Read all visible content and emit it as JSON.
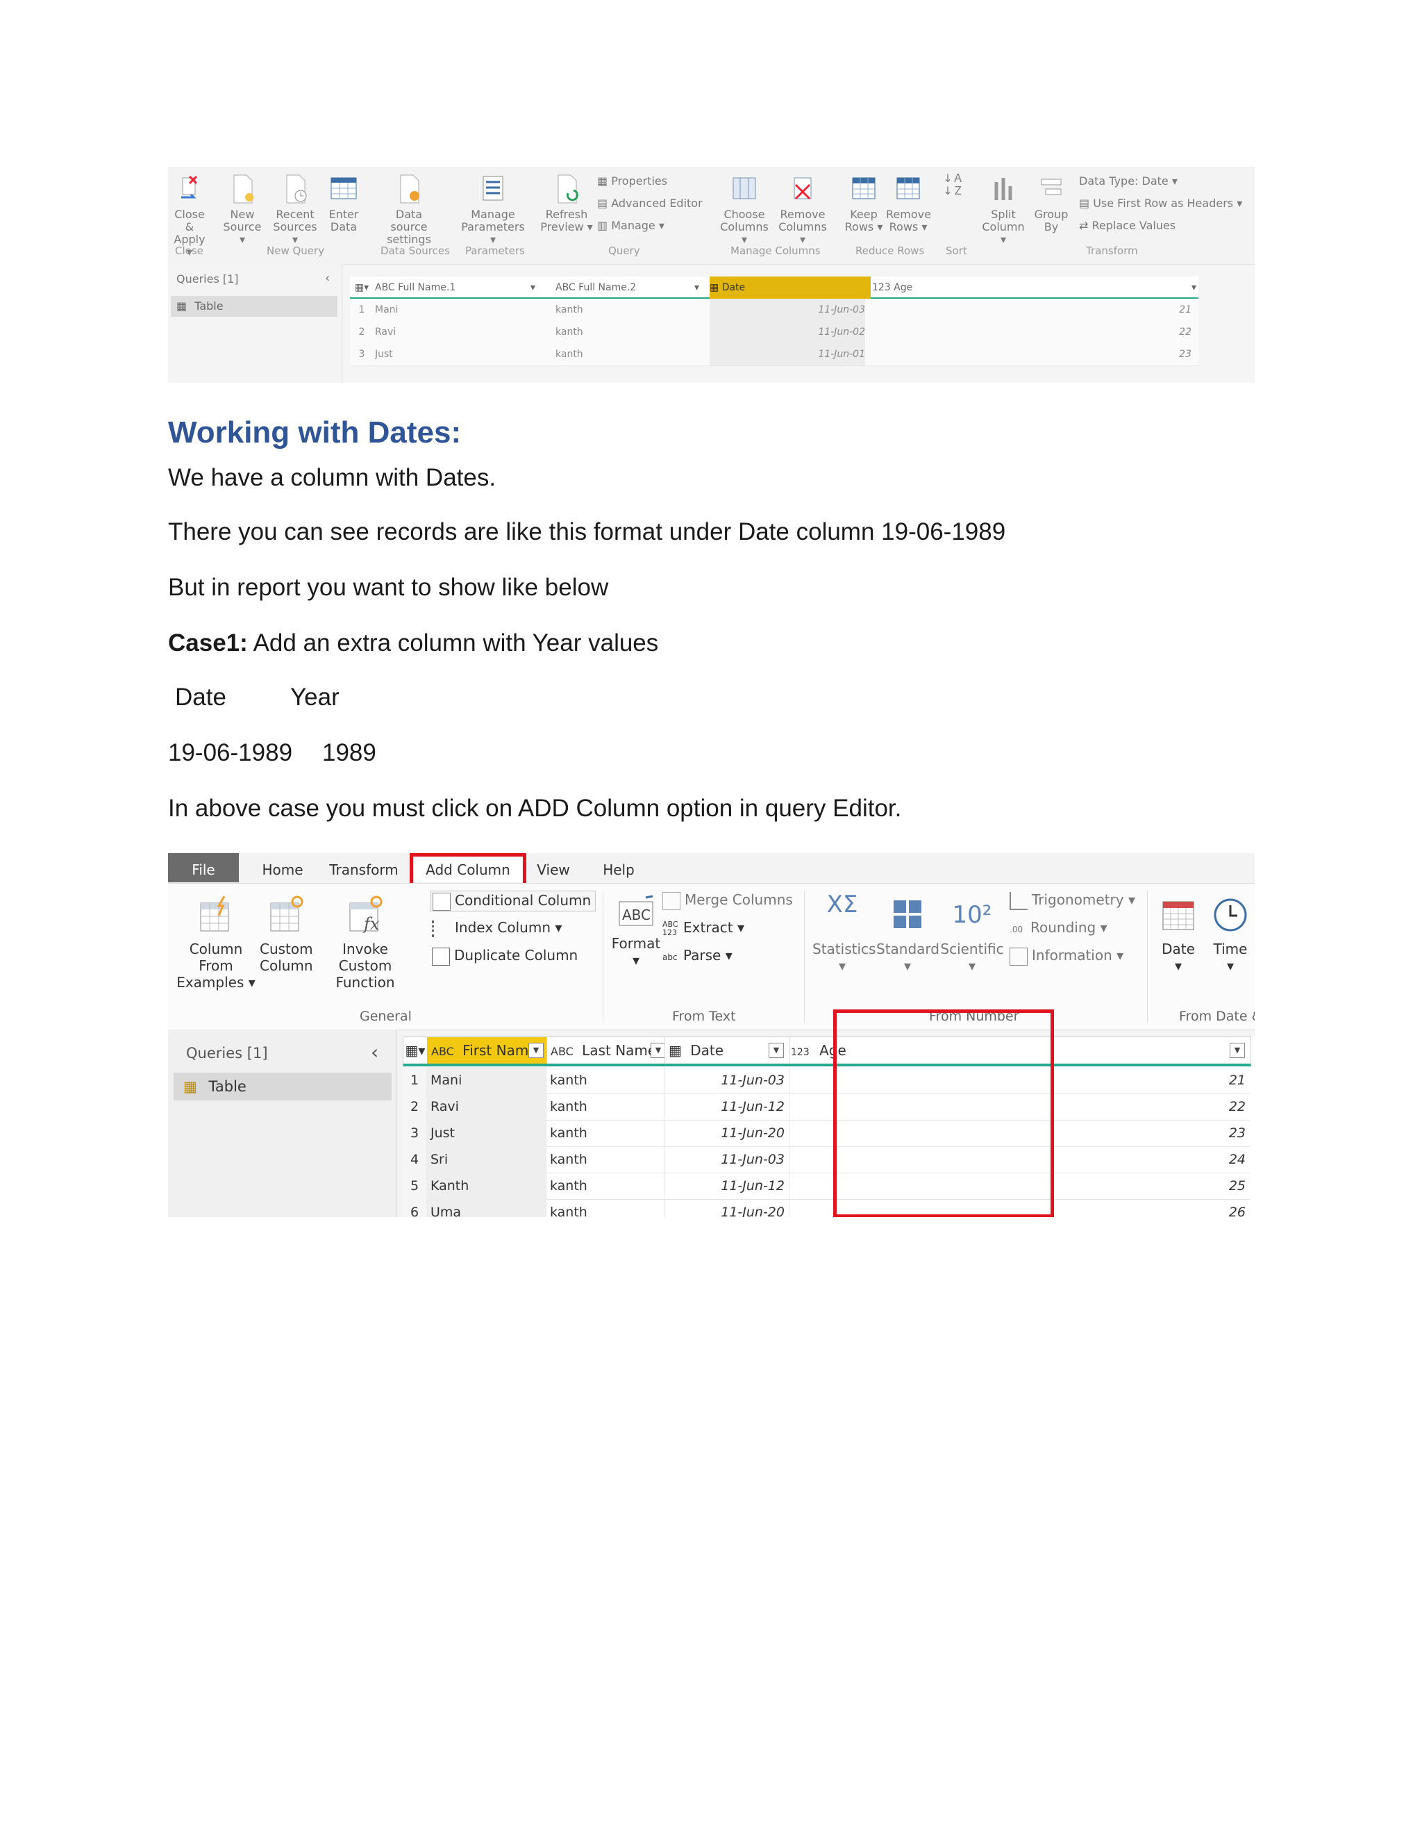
{
  "screenshot1": {
    "ribbon_buttons": [
      {
        "l1": "Close &",
        "l2": "Apply ▾",
        "icon": "close-apply-icon"
      },
      {
        "l1": "New",
        "l2": "Source ▾",
        "icon": "new-source-icon"
      },
      {
        "l1": "Recent",
        "l2": "Sources ▾",
        "icon": "recent-sources-icon"
      },
      {
        "l1": "Enter",
        "l2": "Data",
        "icon": "enter-data-icon"
      },
      {
        "l1": "Data source",
        "l2": "settings",
        "icon": "data-source-settings-icon"
      },
      {
        "l1": "Manage",
        "l2": "Parameters ▾",
        "icon": "manage-parameters-icon"
      },
      {
        "l1": "Refresh",
        "l2": "Preview ▾",
        "icon": "refresh-preview-icon"
      },
      {
        "l1": "Choose",
        "l2": "Columns ▾",
        "icon": "choose-columns-icon"
      },
      {
        "l1": "Remove",
        "l2": "Columns ▾",
        "icon": "remove-columns-icon"
      },
      {
        "l1": "Keep",
        "l2": "Rows ▾",
        "icon": "keep-rows-icon"
      },
      {
        "l1": "Remove",
        "l2": "Rows ▾",
        "icon": "remove-rows-icon"
      },
      {
        "l1": "Split",
        "l2": "Column ▾",
        "icon": "split-column-icon"
      },
      {
        "l1": "Group",
        "l2": "By",
        "icon": "group-by-icon"
      }
    ],
    "query_small": [
      "Properties",
      "Advanced Editor",
      "Manage ▾"
    ],
    "transform_small": [
      "Data Type: Date ▾",
      "Use First Row as Headers ▾",
      "Replace Values"
    ],
    "groups": [
      "Close",
      "New Query",
      "Data Sources",
      "Parameters",
      "Query",
      "Manage Columns",
      "Reduce Rows",
      "Sort",
      "Transform"
    ],
    "queries_label": "Queries [1]",
    "table_label": "Table",
    "columns": [
      "Full Name.1",
      "Full Name.2",
      "Date",
      "Age"
    ],
    "rows": [
      {
        "n": "1",
        "a": "Mani",
        "b": "kanth",
        "date": "11-Jun-03",
        "age": "21"
      },
      {
        "n": "2",
        "a": "Ravi",
        "b": "kanth",
        "date": "11-Jun-02",
        "age": "22"
      },
      {
        "n": "3",
        "a": "Just",
        "b": "kanth",
        "date": "11-Jun-01",
        "age": "23"
      }
    ]
  },
  "text": {
    "heading": "Working with Dates:",
    "p1": "We have a column with Dates.",
    "p2": "There you can see records are like this format  under Date column 19-06-1989",
    "p3": "But in report  you want to show like below",
    "case_label": "Case1:",
    "case_text": " Add an extra column  with Year values",
    "col_date": "Date",
    "col_year": "Year",
    "val_date": "19-06-1989",
    "val_year": "1989",
    "p4": "In above case you must  click on ADD Column option in query Editor."
  },
  "screenshot2": {
    "tabs": [
      "File",
      "Home",
      "Transform",
      "Add Column",
      "View",
      "Help"
    ],
    "general_buttons": [
      {
        "l1": "Column From",
        "l2": "Examples ▾",
        "icon": "column-from-examples-icon"
      },
      {
        "l1": "Custom",
        "l2": "Column",
        "icon": "custom-column-icon"
      },
      {
        "l1": "Invoke Custom",
        "l2": "Function",
        "icon": "invoke-custom-function-icon"
      }
    ],
    "general_small": [
      "Conditional Column",
      "Index Column ▾",
      "Duplicate Column"
    ],
    "format_label": "Format",
    "text_small": [
      "Merge Columns",
      "Extract ▾",
      "Parse ▾"
    ],
    "number_buttons": [
      "Statistics",
      "Standard",
      "Scientific"
    ],
    "number_small": [
      "Trigonometry ▾",
      "Rounding ▾",
      "Information ▾"
    ],
    "date_buttons": [
      "Date",
      "Time"
    ],
    "groups": [
      "General",
      "From Text",
      "From Number",
      "From Date &"
    ],
    "queries_label": "Queries [1]",
    "table_label": "Table",
    "columns": [
      "First Name",
      "Last Name",
      "Date",
      "Age"
    ],
    "rows": [
      {
        "n": "1",
        "first": "Mani",
        "last": "kanth",
        "date": "11-Jun-03",
        "age": "21"
      },
      {
        "n": "2",
        "first": "Ravi",
        "last": "kanth",
        "date": "11-Jun-12",
        "age": "22"
      },
      {
        "n": "3",
        "first": "Just",
        "last": "kanth",
        "date": "11-Jun-20",
        "age": "23"
      },
      {
        "n": "4",
        "first": "Sri",
        "last": "kanth",
        "date": "11-Jun-03",
        "age": "24"
      },
      {
        "n": "5",
        "first": "Kanth",
        "last": "kanth",
        "date": "11-Jun-12",
        "age": "25"
      },
      {
        "n": "6",
        "first": "Uma",
        "last": "kanth",
        "date": "11-Jun-20",
        "age": "26"
      }
    ]
  },
  "colors": {
    "heading": "#2f5597",
    "highlight_red": "#e0141e",
    "date_header": "#f2c811",
    "teal_rule": "#27a98f"
  }
}
